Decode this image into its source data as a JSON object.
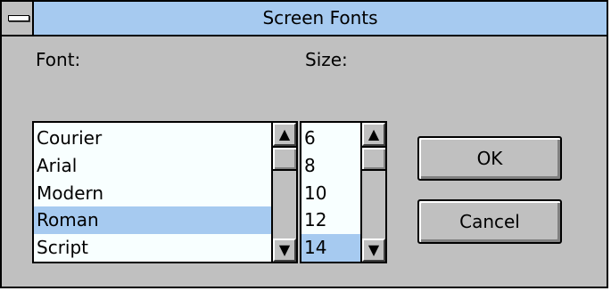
{
  "window": {
    "title": "Screen Fonts"
  },
  "labels": {
    "font": "Font:",
    "size": "Size:"
  },
  "font_list": {
    "items": [
      "Courier",
      "Arial",
      "Modern",
      "Roman",
      "Script"
    ],
    "selected": "Roman"
  },
  "size_list": {
    "items": [
      "6",
      "8",
      "10",
      "12",
      "14"
    ],
    "selected": "14"
  },
  "buttons": {
    "ok": "OK",
    "cancel": "Cancel"
  },
  "icons": {
    "scroll_up": "▲ arrow-up",
    "scroll_down": "▼ arrow-down",
    "system_menu": "minus-bar"
  },
  "colors": {
    "titlebar": "#a6caf0",
    "selection": "#a6caf0",
    "face": "#c0c0c0",
    "list_bg": "#f8ffff"
  }
}
